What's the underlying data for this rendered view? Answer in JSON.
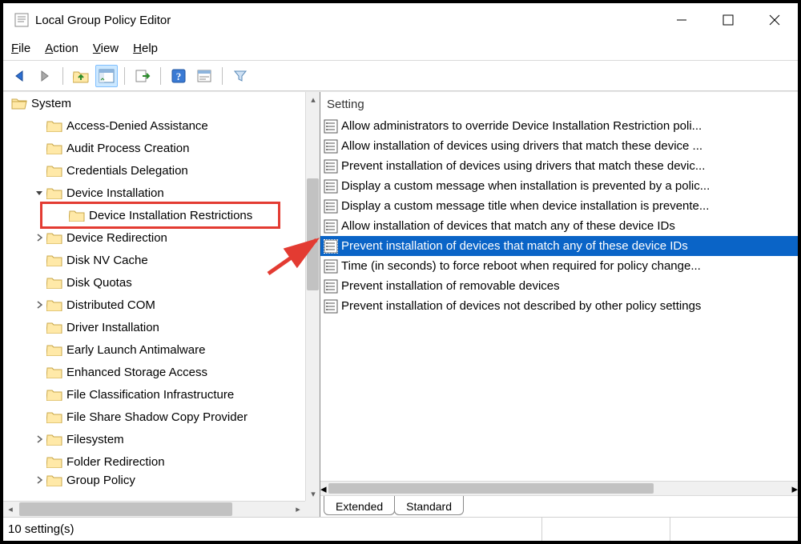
{
  "app": {
    "title": "Local Group Policy Editor"
  },
  "menus": {
    "file": "File",
    "action": "Action",
    "view": "View",
    "help": "Help"
  },
  "toolbar": {
    "back": "back",
    "forward": "forward",
    "up": "up-level",
    "show_hide": "show-hide-tree",
    "export": "export-list",
    "help": "help",
    "show_prop": "show-properties",
    "filter": "filter"
  },
  "tree": {
    "root": "System",
    "items": [
      {
        "label": "Access-Denied Assistance",
        "indent": 1,
        "twisty": ""
      },
      {
        "label": "Audit Process Creation",
        "indent": 1,
        "twisty": ""
      },
      {
        "label": "Credentials Delegation",
        "indent": 1,
        "twisty": ""
      },
      {
        "label": "Device Installation",
        "indent": 1,
        "twisty": "open"
      },
      {
        "label": "Device Installation Restrictions",
        "indent": 2,
        "twisty": "",
        "highlighted": true
      },
      {
        "label": "Device Redirection",
        "indent": 1,
        "twisty": "closed"
      },
      {
        "label": "Disk NV Cache",
        "indent": 1,
        "twisty": ""
      },
      {
        "label": "Disk Quotas",
        "indent": 1,
        "twisty": ""
      },
      {
        "label": "Distributed COM",
        "indent": 1,
        "twisty": "closed"
      },
      {
        "label": "Driver Installation",
        "indent": 1,
        "twisty": ""
      },
      {
        "label": "Early Launch Antimalware",
        "indent": 1,
        "twisty": ""
      },
      {
        "label": "Enhanced Storage Access",
        "indent": 1,
        "twisty": ""
      },
      {
        "label": "File Classification Infrastructure",
        "indent": 1,
        "twisty": ""
      },
      {
        "label": "File Share Shadow Copy Provider",
        "indent": 1,
        "twisty": ""
      },
      {
        "label": "Filesystem",
        "indent": 1,
        "twisty": "closed"
      },
      {
        "label": "Folder Redirection",
        "indent": 1,
        "twisty": ""
      },
      {
        "label": "Group Policy",
        "indent": 1,
        "twisty": "closed",
        "cut": true
      }
    ]
  },
  "list": {
    "header": "Setting",
    "rows": [
      {
        "label": "Allow administrators to override Device Installation Restriction poli..."
      },
      {
        "label": "Allow installation of devices using drivers that match these device ..."
      },
      {
        "label": "Prevent installation of devices using drivers that match these devic..."
      },
      {
        "label": "Display a custom message when installation is prevented by a polic..."
      },
      {
        "label": "Display a custom message title when device installation is prevente..."
      },
      {
        "label": "Allow installation of devices that match any of these device IDs"
      },
      {
        "label": "Prevent installation of devices that match any of these device IDs",
        "selected": true
      },
      {
        "label": "Time (in seconds) to force reboot when required for policy change..."
      },
      {
        "label": "Prevent installation of removable devices"
      },
      {
        "label": "Prevent installation of devices not described by other policy settings"
      }
    ]
  },
  "tabs": {
    "extended": "Extended",
    "standard": "Standard"
  },
  "status": {
    "count": "10 setting(s)"
  }
}
